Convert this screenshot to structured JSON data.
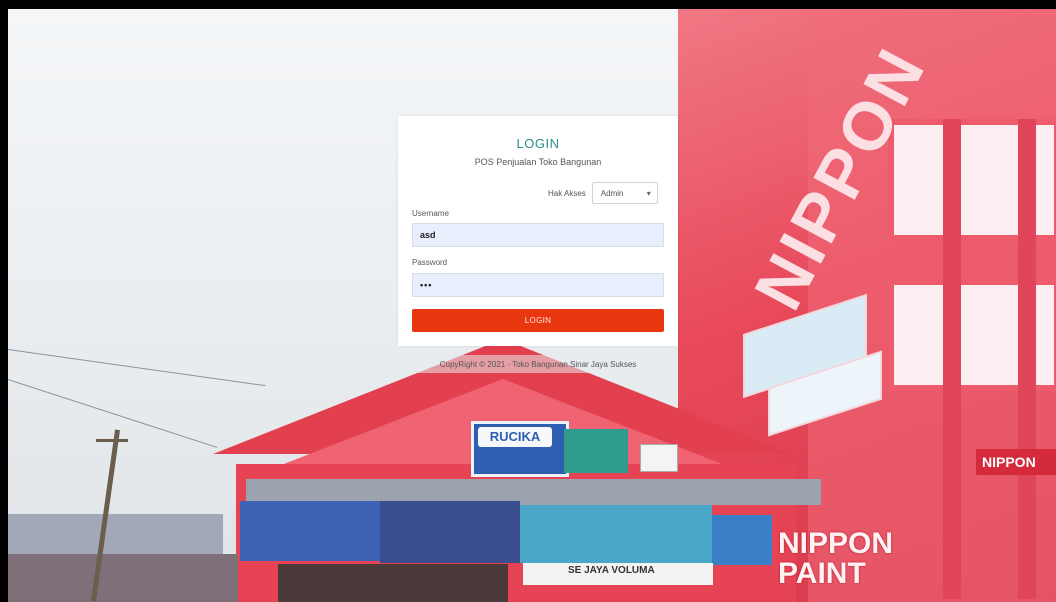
{
  "login": {
    "title": "LOGIN",
    "subtitle": "POS Penjualan Toko Bangunan",
    "role_label": "Hak Akses",
    "role_selected": "Admin",
    "username_label": "Username",
    "username_value": "asd",
    "password_label": "Password",
    "password_value": "•••",
    "submit_label": "LOGIN"
  },
  "footer": {
    "copyright": "CopyRight © 2021 · Toko Bangunan Sinar Jaya Sukses"
  },
  "background": {
    "signs": {
      "rucika": "RUCIKA",
      "nippon_top": "NIPPON",
      "nippon_main": "NIPPON\nPAINT",
      "store_name": "SE JAYA   VOLUMA"
    }
  },
  "colors": {
    "accent_title": "#2f8f86",
    "login_button": "#e8360f",
    "input_bg": "#e9eefc"
  }
}
